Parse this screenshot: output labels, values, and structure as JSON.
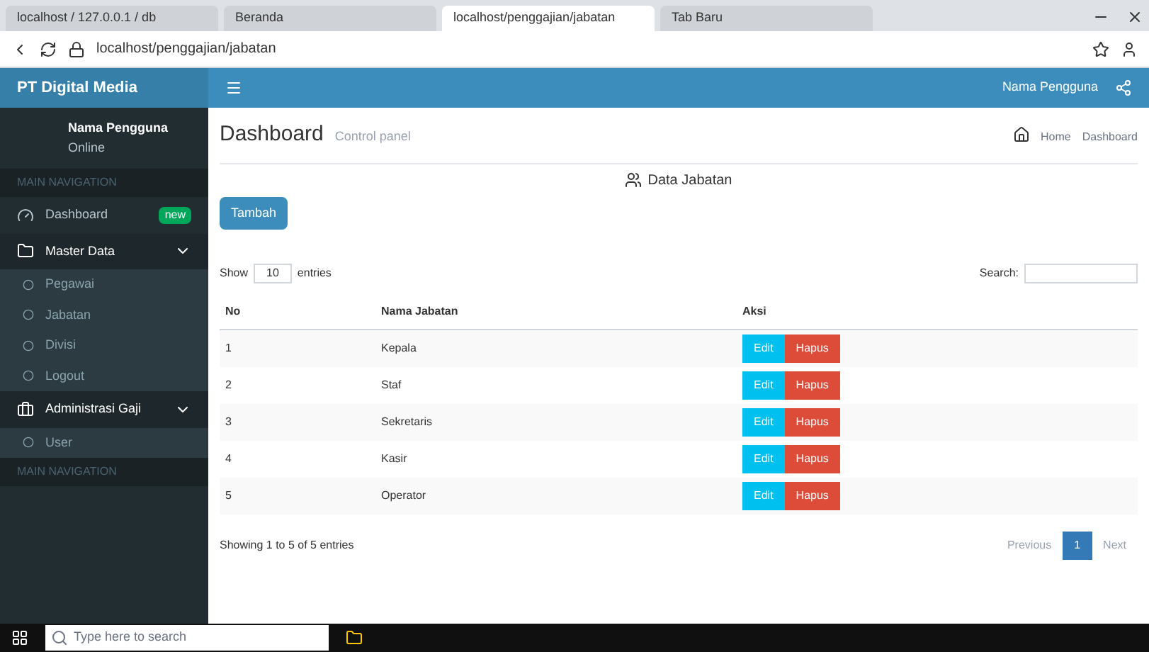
{
  "browser": {
    "tabs": [
      {
        "title": "localhost / 127.0.0.1 / db",
        "selected": false
      },
      {
        "title": "Beranda",
        "selected": false
      },
      {
        "title": "localhost/penggajian/jabatan",
        "selected": true
      },
      {
        "title": "Tab Baru",
        "selected": false
      }
    ],
    "url": "localhost/penggajian/jabatan"
  },
  "header": {
    "brand": "PT Digital Media",
    "user": "Nama Pengguna"
  },
  "sidebar": {
    "user": {
      "name": "Nama Pengguna",
      "status": "Online"
    },
    "section": "MAIN NAVIGATION",
    "items": [
      {
        "label": "Dashboard",
        "badge": "new",
        "expanded": false
      },
      {
        "label": "Master Data",
        "expanded": true,
        "children": [
          {
            "label": "Pegawai"
          },
          {
            "label": "Jabatan"
          },
          {
            "label": "Divisi"
          },
          {
            "label": "Logout"
          }
        ]
      },
      {
        "label": "Administrasi Gaji",
        "expanded": true,
        "children": [
          {
            "label": "User"
          }
        ]
      }
    ],
    "footer": "MAIN NAVIGATION"
  },
  "page": {
    "title": "Dashboard",
    "subtitle": "Control panel",
    "breadcrumb": [
      "Home",
      "Dashboard"
    ],
    "box_title": "Data Jabatan",
    "add_button": "Tambah",
    "length": {
      "before": "Show",
      "value": "10",
      "after": "entries"
    },
    "search_label": "Search:",
    "table": {
      "columns": [
        "No",
        "Nama Jabatan",
        "Aksi"
      ],
      "rows": [
        {
          "no": "1",
          "name": "Kepala",
          "edit": "Edit",
          "delete": "Hapus"
        },
        {
          "no": "2",
          "name": "Staf",
          "edit": "Edit",
          "delete": "Hapus"
        },
        {
          "no": "3",
          "name": "Sekretaris",
          "edit": "Edit",
          "delete": "Hapus"
        },
        {
          "no": "4",
          "name": "Kasir",
          "edit": "Edit",
          "delete": "Hapus"
        },
        {
          "no": "5",
          "name": "Operator",
          "edit": "Edit",
          "delete": "Hapus"
        }
      ]
    },
    "info": "Showing 1 to 5 of 5 entries",
    "pagination": [
      {
        "label": "Previous",
        "selected": false
      },
      {
        "label": "1",
        "selected": true
      },
      {
        "label": "Next",
        "selected": false
      }
    ]
  },
  "taskbar": {
    "search_placeholder": "Type here to search"
  }
}
